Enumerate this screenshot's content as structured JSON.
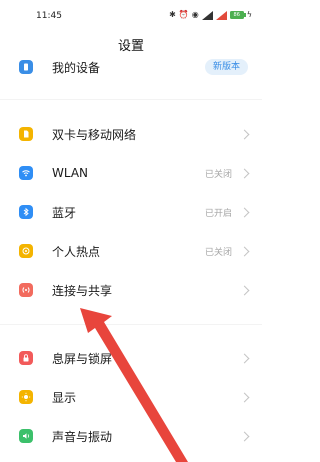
{
  "status_bar": {
    "time": "11:45",
    "battery_level": "86",
    "icons": [
      "bluetooth-icon",
      "alarm-icon",
      "nfc-icon",
      "signal-icon",
      "wifi-icon"
    ]
  },
  "page": {
    "title": "设置"
  },
  "top_item": {
    "label": "我的设备",
    "badge": "新版本",
    "icon_color": "#3a8ee6"
  },
  "items": [
    {
      "key": "sim",
      "label": "双卡与移动网络",
      "status": "",
      "icon_color": "#f4b400"
    },
    {
      "key": "wlan",
      "label": "WLAN",
      "status": "已关闭",
      "icon_color": "#2f8ef5"
    },
    {
      "key": "bluetooth",
      "label": "蓝牙",
      "status": "已开启",
      "icon_color": "#2f8ef5"
    },
    {
      "key": "hotspot",
      "label": "个人热点",
      "status": "已关闭",
      "icon_color": "#f4b400"
    },
    {
      "key": "connect",
      "label": "连接与共享",
      "status": "",
      "icon_color": "#f26b5e"
    },
    {
      "key": "lock",
      "label": "息屏与锁屏",
      "status": "",
      "icon_color": "#f25a5a"
    },
    {
      "key": "display",
      "label": "显示",
      "status": "",
      "icon_color": "#f4b400"
    },
    {
      "key": "sound",
      "label": "声音与振动",
      "status": "",
      "icon_color": "#3cc06b"
    }
  ],
  "colors": {
    "arrow": "#e8453c",
    "background": "#ffffff"
  }
}
